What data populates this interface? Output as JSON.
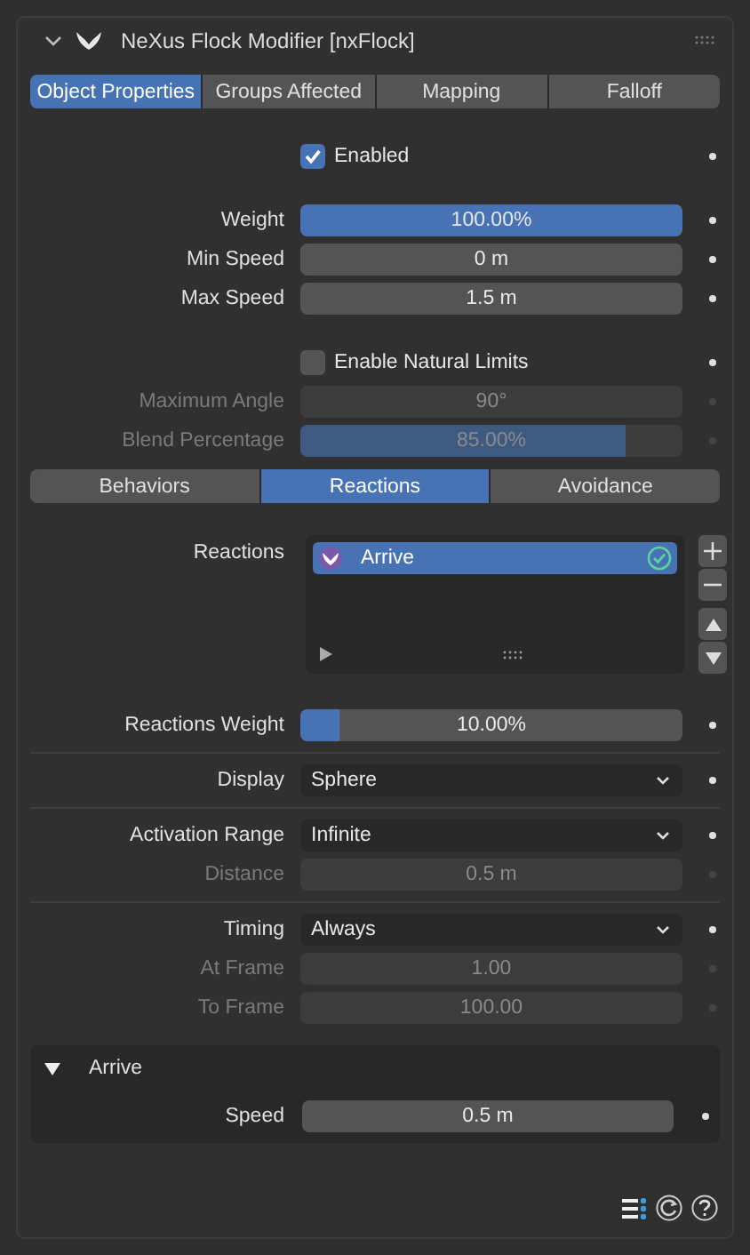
{
  "panel": {
    "title": "NeXus Flock Modifier [nxFlock]",
    "expanded": true
  },
  "sections": [
    {
      "kind": "tabs",
      "tabs": [
        {
          "label": "Object Properties",
          "selected": true
        },
        {
          "label": "Groups Affected",
          "selected": false
        },
        {
          "label": "Mapping",
          "selected": false
        },
        {
          "label": "Falloff",
          "selected": false
        }
      ]
    },
    {
      "kind": "rows",
      "divider": false,
      "rows": [
        {
          "kind": "checkbox",
          "label": "Enabled",
          "checked": true,
          "disabled": false
        }
      ]
    },
    {
      "kind": "rows",
      "divider": false,
      "rows": [
        {
          "kind": "slider",
          "label": "Weight",
          "value": "100.00%",
          "level": 1,
          "disabled": false
        },
        {
          "kind": "field",
          "label": "Min Speed",
          "value": "0 m",
          "disabled": false
        },
        {
          "kind": "field",
          "label": "Max Speed",
          "value": "1.5 m",
          "disabled": false
        }
      ]
    },
    {
      "kind": "rows",
      "divider": false,
      "rows": [
        {
          "kind": "checkbox",
          "label": "Enable Natural Limits",
          "checked": false,
          "disabled": false
        },
        {
          "kind": "field",
          "label": "Maximum Angle",
          "value": "90°",
          "disabled": true
        },
        {
          "kind": "slider",
          "label": "Blend Percentage",
          "value": "85.00%",
          "level": 0.85,
          "disabled": true
        }
      ]
    },
    {
      "kind": "tabs",
      "tabs": [
        {
          "label": "Behaviors",
          "selected": false
        },
        {
          "label": "Reactions",
          "selected": true
        },
        {
          "label": "Avoidance",
          "selected": false
        }
      ]
    },
    {
      "kind": "list",
      "label": "Reactions",
      "items": [
        {
          "name": "Arrive",
          "selected": true,
          "enabled": true
        }
      ]
    },
    {
      "kind": "rows",
      "divider": false,
      "rows": [
        {
          "kind": "slider",
          "label": "Reactions Weight",
          "value": "10.00%",
          "level": 0.1,
          "disabled": false
        }
      ]
    },
    {
      "kind": "rows",
      "divider": true,
      "rows": [
        {
          "kind": "dropdown",
          "label": "Display",
          "value": "Sphere",
          "disabled": false
        }
      ]
    },
    {
      "kind": "rows",
      "divider": true,
      "rows": [
        {
          "kind": "dropdown",
          "label": "Activation Range",
          "value": "Infinite",
          "disabled": false
        },
        {
          "kind": "field",
          "label": "Distance",
          "value": "0.5 m",
          "disabled": true
        }
      ]
    },
    {
      "kind": "rows",
      "divider": true,
      "rows": [
        {
          "kind": "dropdown",
          "label": "Timing",
          "value": "Always",
          "disabled": false
        },
        {
          "kind": "field",
          "label": "At Frame",
          "value": "1.00",
          "disabled": true
        },
        {
          "kind": "field",
          "label": "To Frame",
          "value": "100.00",
          "disabled": true
        }
      ]
    },
    {
      "kind": "subpanel",
      "title": "Arrive",
      "expanded": true,
      "rows": [
        {
          "kind": "field",
          "label": "Speed",
          "value": "0.5 m",
          "disabled": false
        }
      ]
    }
  ]
}
